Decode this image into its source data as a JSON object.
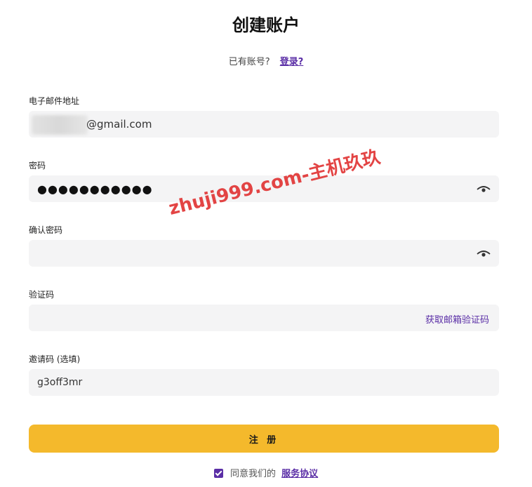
{
  "header": {
    "title": "创建账户",
    "have_account_text": "已有账号?",
    "login_link": "登录?"
  },
  "form": {
    "email": {
      "label": "电子邮件地址",
      "value_visible": "@gmail.com"
    },
    "password": {
      "label": "密码",
      "masked_value": "●●●●●●●●●●●"
    },
    "confirm_password": {
      "label": "确认密码",
      "value": ""
    },
    "verification_code": {
      "label": "验证码",
      "value": "",
      "get_code_label": "获取邮箱验证码"
    },
    "invite_code": {
      "label": "邀请码 (选填)",
      "value": "g3off3mr"
    },
    "submit_label": "注 册"
  },
  "agreement": {
    "checked": true,
    "text": "同意我们的",
    "link": "服务协议"
  },
  "watermark": "zhuji999.com-主机玖玖",
  "colors": {
    "accent_purple": "#5a2ea6",
    "button_yellow": "#f4b92c",
    "field_bg": "#f4f4f5",
    "watermark_red": "#e23b3b"
  }
}
